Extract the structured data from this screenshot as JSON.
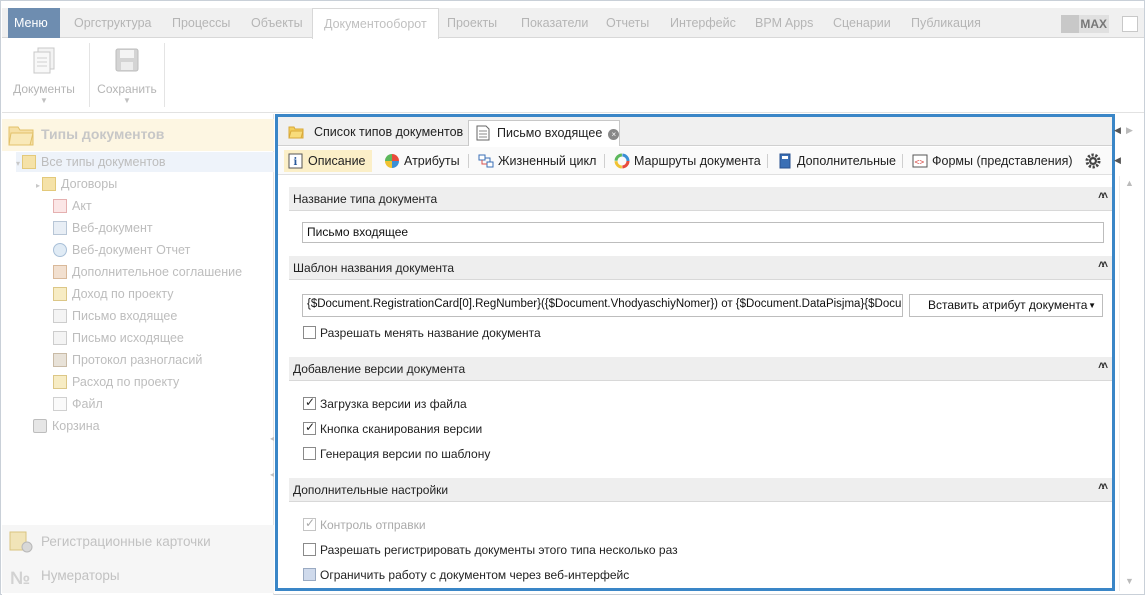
{
  "menubar": {
    "menu_label": "Меню",
    "tabs": [
      "Оргструктура",
      "Процессы",
      "Объекты",
      "Документооборот",
      "Проекты",
      "Показатели",
      "Отчеты",
      "Интерфейс",
      "BPM Apps",
      "Сценарии",
      "Публикация"
    ],
    "active_tab": "Документооборот",
    "badge": "MAX"
  },
  "ribbon": {
    "documents_label": "Документы",
    "save_label": "Сохранить"
  },
  "sidebar": {
    "header": "Типы документов",
    "tree": [
      "Все типы документов",
      "Договоры",
      "Акт",
      "Веб-документ",
      "Веб-документ Отчет",
      "Дополнительное соглашение",
      "Доход по проекту",
      "Письмо входящее",
      "Письмо исходящее",
      "Протокол разногласий",
      "Расход по проекту",
      "Файл",
      "Корзина"
    ],
    "bottom_items": [
      "Регистрационные карточки",
      "Нумераторы"
    ]
  },
  "doc_tabs": {
    "tab1": "Список типов документов",
    "tab2": "Письмо входящее",
    "close_glyph": "×",
    "left_arrow": "◀",
    "right_arrow": "▶"
  },
  "sub_tabs": {
    "items": [
      "Описание",
      "Атрибуты",
      "Жизненный цикл",
      "Маршруты документа",
      "Дополнительные",
      "Формы (представления)"
    ]
  },
  "content": {
    "sections": {
      "name_type": "Название типа документа",
      "name_template": "Шаблон названия документа",
      "add_version": "Добавление версии документа",
      "extra": "Дополнительные настройки"
    },
    "chevron": "˄˄",
    "name_value": "Письмо входящее",
    "template_value": "{$Document.RegistrationCard[0].RegNumber}({$Document.VhodyaschiyNomer}) от {$Document.DataPisjma}{$Docum",
    "insert_attr_label": "Вставить атрибут документа",
    "dropdown_caret": "▼",
    "allow_rename": "Разрешать менять название документа",
    "version_from_file": "Загрузка версии из файла",
    "scan_button": "Кнопка сканирования версии",
    "generate_by_template": "Генерация версии по шаблону",
    "send_control": "Контроль отправки",
    "allow_multi_register": "Разрешать регистрировать документы этого типа несколько раз",
    "restrict_web": "Ограничить работу с документом через веб-интерфейс"
  },
  "colors": {
    "accent": "#3a86c7",
    "menu_bg": "#6e8db0",
    "active_subtab": "#fbefc8"
  }
}
